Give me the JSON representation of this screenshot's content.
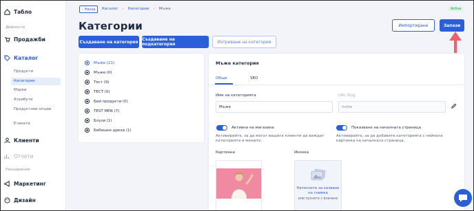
{
  "sidebar": {
    "items": [
      {
        "label": "Табло",
        "icon": "home-icon"
      },
      {
        "label": "Продажби",
        "icon": "cart-icon"
      },
      {
        "label": "Каталог",
        "icon": "tag-icon"
      },
      {
        "label": "Клиенти",
        "icon": "users-icon"
      },
      {
        "label": "Отчети",
        "icon": "chart-icon"
      },
      {
        "label": "Маркетинг",
        "icon": "megaphone-icon"
      },
      {
        "label": "Дизайн",
        "icon": "palette-icon"
      }
    ],
    "section_actions": "Дейности",
    "section_extensions": "Разширения",
    "catalog_sub": [
      "Продукти",
      "Категории",
      "Марки",
      "Атрибути",
      "Продуктови опции",
      "Етикети"
    ]
  },
  "topbar": {
    "back_label": "Назад",
    "breadcrumbs": [
      "Каталог",
      "Категории",
      "Мъже"
    ],
    "status_badge": "Active"
  },
  "page": {
    "title": "Категории",
    "import_label": "Импортиране",
    "save_label": "Запази",
    "create_category": "Създаване на категория",
    "create_subcategory": "Създаване на подкатегория",
    "delete_category": "Изтриване на категория"
  },
  "tree": [
    {
      "label": "Мъже (21)",
      "selected": true
    },
    {
      "label": "Мъже (0)"
    },
    {
      "label": "Тест (9)"
    },
    {
      "label": "ТЕСТ (0)"
    },
    {
      "label": "Бий продукти (0)"
    },
    {
      "label": "TEST MEN (7)"
    },
    {
      "label": "Блузи (1)"
    },
    {
      "label": "Бебешки дрехи (1)"
    }
  ],
  "panel": {
    "title": "Мъже категория",
    "tabs": [
      "Общи",
      "SEO"
    ],
    "name_label": "Име на категорията",
    "name_value": "Мъже",
    "slug_label": "URL Slug",
    "slug_value": "mzhe",
    "toggle_menu_label": "Активна на магазина",
    "toggle_menu_help": "Активирайте, за да могат вашите клиенти да виждат категорията в менюто.",
    "toggle_home_label": "Показване на началната страница",
    "toggle_home_help": "Активирайте, за да добавите категорията с нейната картинка на началната страница.",
    "image_label": "Картинка",
    "icon_label": "Иконка",
    "upload_link": "Натиснете за качване на снимка",
    "upload_or": "или пуснете с влачене"
  },
  "colors": {
    "accent": "#2b5fd9",
    "arrow": "#e8636c",
    "active_badge": "#1e9e52"
  }
}
